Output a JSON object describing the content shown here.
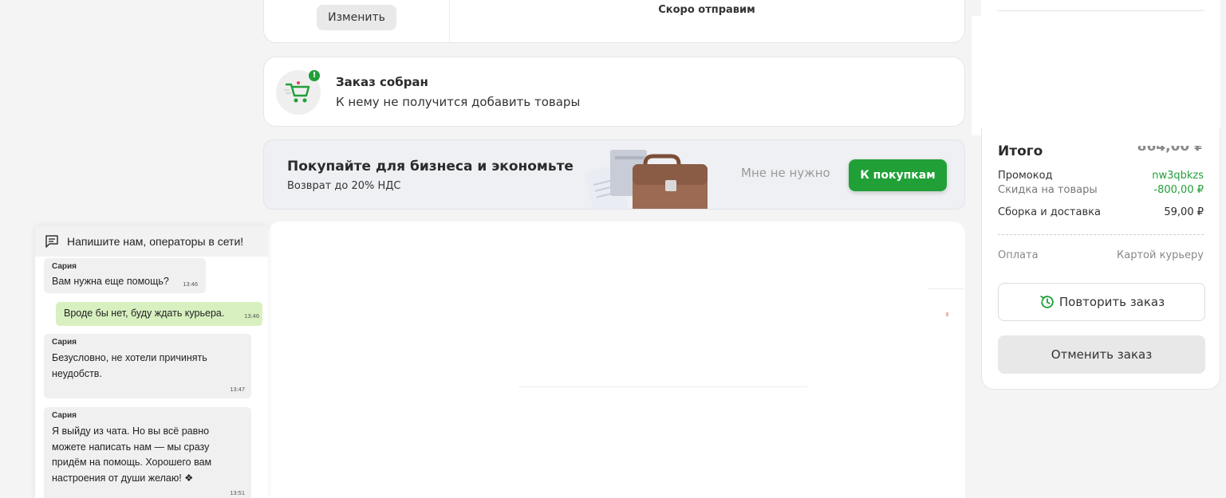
{
  "delivery": {
    "change_label": "Изменить",
    "status_text": "Скоро отправим"
  },
  "collected": {
    "title": "Заказ собран",
    "subtitle": "К нему не получится добавить товары",
    "badge": "!"
  },
  "business_banner": {
    "title": "Покупайте для бизнеса и экономьте",
    "subtitle": "Возврат до 20% НДС",
    "dismiss_label": "Мне не нужно",
    "cta_label": "К покупкам"
  },
  "summary": {
    "total_label": "Итого",
    "total_value": "864,00 ₽",
    "rows": {
      "promo": {
        "label": "Промокод",
        "value": "nw3qbkzs"
      },
      "discount": {
        "label": "Скидка на товары",
        "value": "-800,00 ₽"
      },
      "delivery": {
        "label": "Сборка и доставка",
        "value": "59,00 ₽"
      },
      "payment": {
        "label": "Оплата",
        "value": "Картой курьеру"
      }
    },
    "repeat_label": "Повторить заказ",
    "cancel_label": "Отменить заказ"
  },
  "chat": {
    "header": "Напишите нам, операторы в сети!",
    "messages": [
      {
        "author": "Сария",
        "text": "Вам нужна еще помощь?",
        "time": "13:46"
      },
      {
        "author": "",
        "text": "Вроде бы нет, буду ждать курьера.",
        "time": "13:46"
      },
      {
        "author": "Сария",
        "text": "Безусловно, не хотели причинять неудобств.",
        "time": "13:47"
      },
      {
        "author": "Сария",
        "text": "Я выйду из чата. Но вы всё равно можете написать нам — мы сразу придём на помощь. Хорошего вам настроения от души желаю! ❖",
        "time": "13:51"
      }
    ]
  },
  "colors": {
    "accent_green": "#21a038",
    "page_bg": "#f4f4f4",
    "my_message_bg": "#d8f0c0"
  }
}
